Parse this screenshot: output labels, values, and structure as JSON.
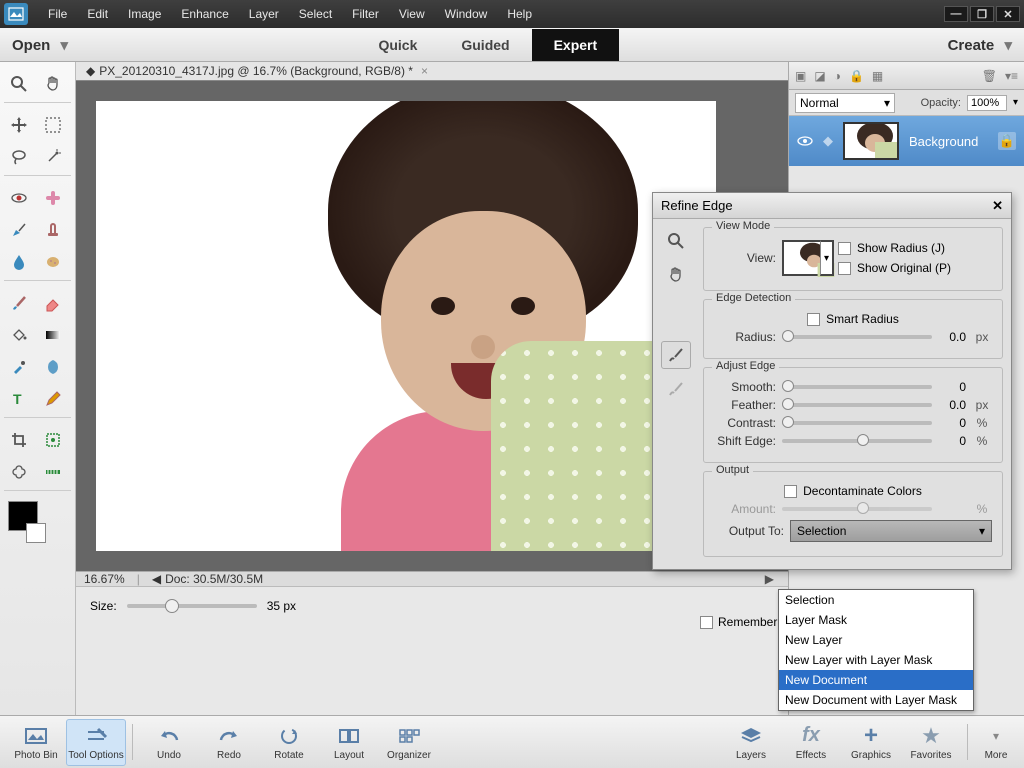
{
  "menu": {
    "items": [
      "File",
      "Edit",
      "Image",
      "Enhance",
      "Layer",
      "Select",
      "Filter",
      "View",
      "Window",
      "Help"
    ]
  },
  "modebar": {
    "open": "Open",
    "tabs": [
      "Quick",
      "Guided",
      "Expert"
    ],
    "active": 2,
    "create": "Create"
  },
  "doc": {
    "tab": "PX_20120310_4317J.jpg @ 16.7% (Background, RGB/8) *",
    "zoom": "16.67%",
    "docinfo": "Doc: 30.5M/30.5M"
  },
  "options": {
    "size_label": "Size:",
    "size_value": "35 px"
  },
  "layers": {
    "blend_mode": "Normal",
    "opacity_label": "Opacity:",
    "opacity_value": "100%",
    "items": [
      {
        "name": "Background"
      }
    ]
  },
  "dialog": {
    "title": "Refine Edge",
    "view_mode": {
      "legend": "View Mode",
      "view_label": "View:",
      "show_radius": "Show Radius (J)",
      "show_original": "Show Original (P)"
    },
    "edge_detection": {
      "legend": "Edge Detection",
      "smart_radius": "Smart Radius",
      "radius_label": "Radius:",
      "radius_value": "0.0",
      "radius_unit": "px"
    },
    "adjust_edge": {
      "legend": "Adjust Edge",
      "smooth_label": "Smooth:",
      "smooth_value": "0",
      "feather_label": "Feather:",
      "feather_value": "0.0",
      "feather_unit": "px",
      "contrast_label": "Contrast:",
      "contrast_value": "0",
      "contrast_unit": "%",
      "shift_label": "Shift Edge:",
      "shift_value": "0",
      "shift_unit": "%"
    },
    "output": {
      "legend": "Output",
      "decon": "Decontaminate Colors",
      "amount_label": "Amount:",
      "amount_unit": "%",
      "to_label": "Output To:",
      "to_value": "Selection"
    },
    "remember": "Remember"
  },
  "dropdown": {
    "items": [
      "Selection",
      "Layer Mask",
      "New Layer",
      "New Layer with Layer Mask",
      "New Document",
      "New Document with Layer Mask"
    ],
    "highlight": 4
  },
  "bottombar": {
    "left": [
      {
        "label": "Photo Bin"
      },
      {
        "label": "Tool Options"
      },
      {
        "label": "Undo"
      },
      {
        "label": "Redo"
      },
      {
        "label": "Rotate"
      },
      {
        "label": "Layout"
      },
      {
        "label": "Organizer"
      }
    ],
    "right": [
      {
        "label": "Layers"
      },
      {
        "label": "Effects"
      },
      {
        "label": "Graphics"
      },
      {
        "label": "Favorites"
      },
      {
        "label": "More"
      }
    ]
  }
}
